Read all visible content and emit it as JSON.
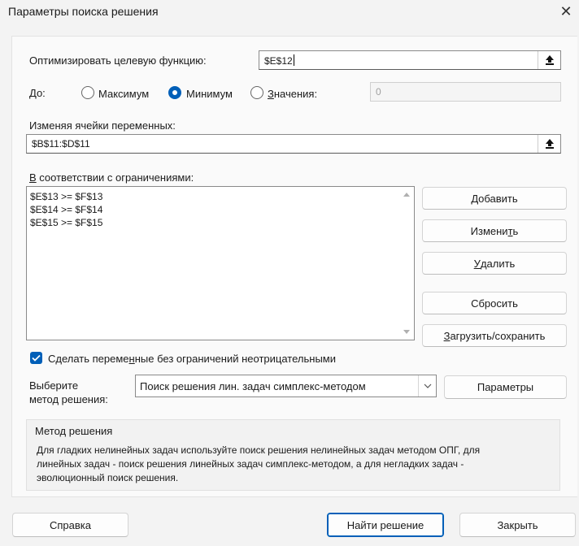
{
  "window": {
    "title": "Параметры поиска решения",
    "close_glyph": "✕"
  },
  "objective": {
    "label": "Оптимизировать целевую функцию:",
    "value": "$E$12"
  },
  "to": {
    "label": "До:",
    "max_label": "Максимум",
    "min_label": "Минимум",
    "value_prefix": "З",
    "value_rest": "начения:",
    "selected": "min",
    "value_input": "0"
  },
  "variables": {
    "label": "Изменяя ячейки переменных:",
    "value": "$B$11:$D$11"
  },
  "constraints": {
    "label_u": "В",
    "label_rest": " соответствии с ограничениями:",
    "items": [
      "$E$13 >= $F$13",
      "$E$14 >= $F$14",
      "$E$15 >= $F$15"
    ]
  },
  "buttons": {
    "add_u": "Д",
    "add_rest": "обавить",
    "change_pre": "Измени",
    "change_u": "т",
    "change_post": "ь",
    "delete_u": "У",
    "delete_rest": "далить",
    "reset": "Сбросить",
    "load_u": "З",
    "load_rest": "агрузить/сохранить",
    "params": "Параметры",
    "help": "Справка",
    "solve": "Найти решение",
    "close": "Закрыть"
  },
  "nonneg": {
    "label_pre": "Сделать переме",
    "label_u": "н",
    "label_post": "ные без ограничений неотрицательными",
    "checked": true
  },
  "method": {
    "label_line1": "Выберите",
    "label_line2": "метод решения:",
    "selected": "Поиск решения лин. задач симплекс-методом"
  },
  "method_info": {
    "title": "Метод решения",
    "line1": "Для гладких нелинейных задач используйте поиск решения нелинейных задач методом ОПГ, для",
    "line2": "линейных задач - поиск решения линейных задач симплекс-методом, а для негладких задач -",
    "line3": "эволюционный поиск решения."
  },
  "colors": {
    "accent": "#005fb8",
    "background": "#f3f3f3"
  },
  "icons": {
    "ref_button": "collapse-dialog-icon",
    "dropdown": "chevron-down-icon",
    "check": "checkmark-icon"
  }
}
